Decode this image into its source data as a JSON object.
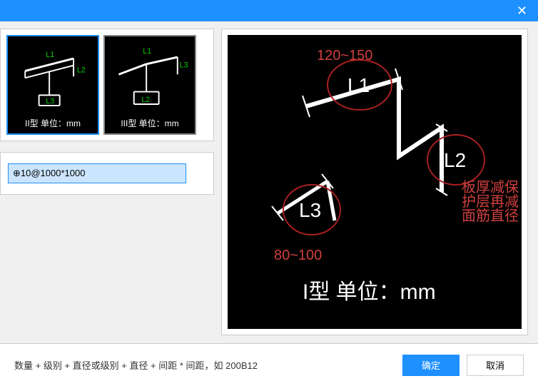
{
  "titlebar": {
    "close": "✕"
  },
  "thumbs": [
    {
      "label": "II型 单位：mm",
      "labels_inside": {
        "l1": "L1",
        "l2": "L2",
        "l3": "L3"
      }
    },
    {
      "label": "III型 单位：mm",
      "labels_inside": {
        "l1": "L1",
        "l2": "L2",
        "l3": "L3"
      }
    }
  ],
  "input": {
    "value": "⊕10@1000*1000"
  },
  "preview": {
    "range1": "120~150",
    "l1": "L1",
    "l2": "L2",
    "l3": "L3",
    "range2": "80~100",
    "caption": "I型 单位：mm",
    "note_line1": "板厚减保",
    "note_line2": "护层再减",
    "note_line3": "面筋直径"
  },
  "footer": {
    "hint": "数量 + 级别 + 直径或级别 + 直径 + 间距 * 间距，如 200B12",
    "ok": "确定",
    "cancel": "取消"
  }
}
